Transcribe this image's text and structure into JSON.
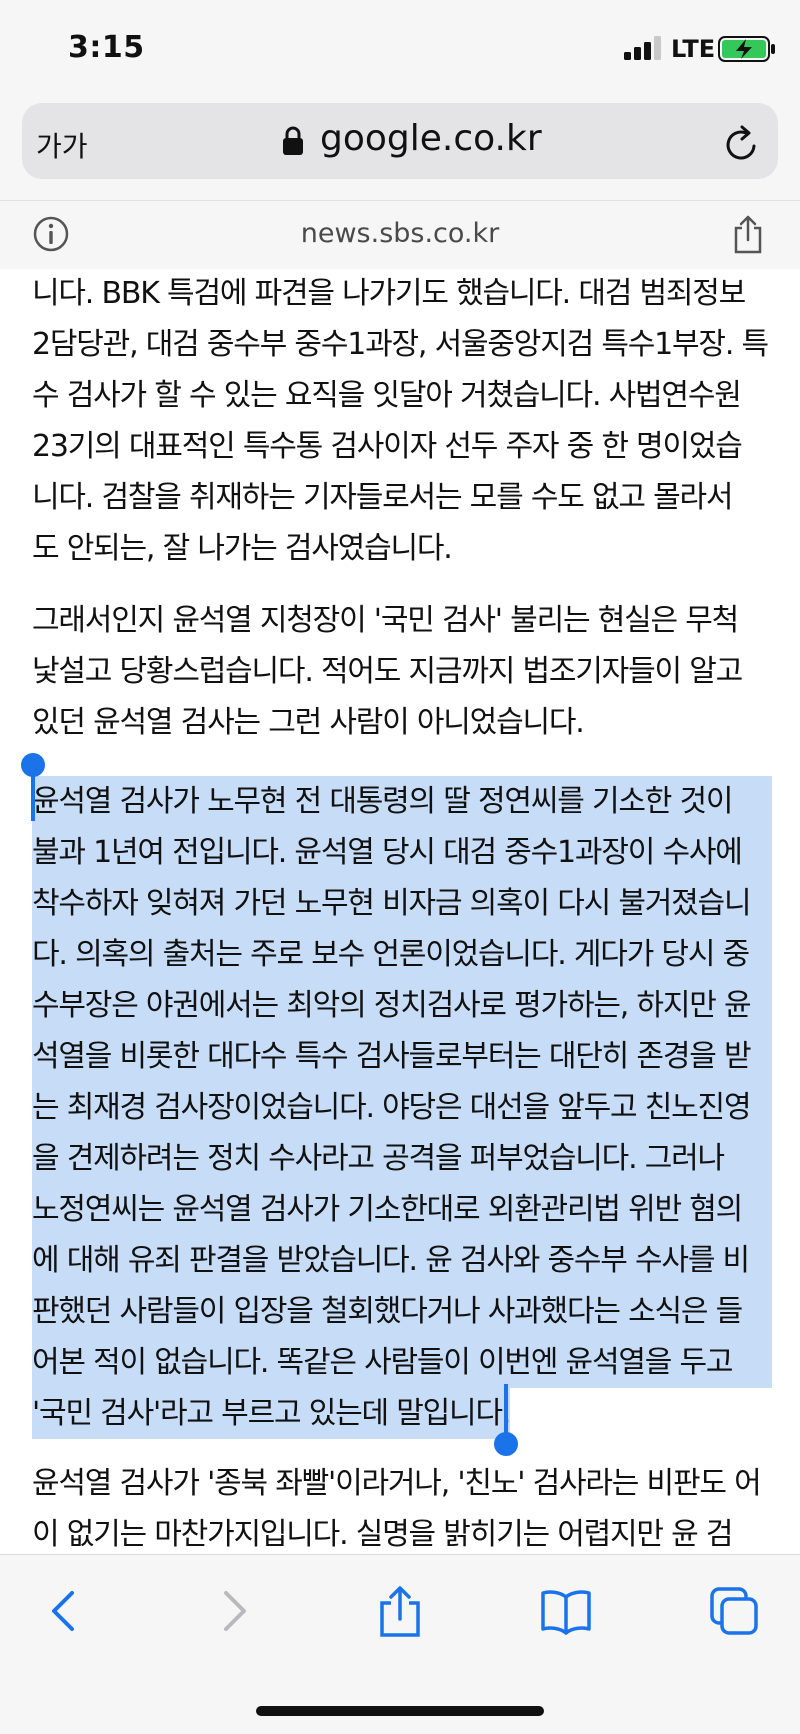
{
  "status_bar": {
    "time": "3:15",
    "network": "LTE",
    "battery_color": "#34c759"
  },
  "browser": {
    "text_size_label": "가가",
    "url": "google.co.kr",
    "site": "news.sbs.co.kr",
    "accent_color": "#1a73e8"
  },
  "article": {
    "paragraphs": [
      {
        "lines": [
          "니다. BBK 특검에 파견을 나가기도 했습니다.  대검 범죄정보",
          "2담당관, 대검 중수부 중수1과장, 서울중앙지검 특수1부장. 특",
          "수 검사가 할 수 있는 요직을 잇달아 거쳤습니다. 사법연수원",
          "23기의 대표적인 특수통 검사이자 선두 주자 중 한 명이었습",
          "니다. 검찰을 취재하는 기자들로서는 모를 수도 없고 몰라서",
          "도 안되는, 잘 나가는 검사였습니다."
        ]
      },
      {
        "lines": [
          "그래서인지 윤석열 지청장이 '국민 검사' 불리는 현실은 무척",
          "낯설고 당황스럽습니다. 적어도 지금까지 법조기자들이 알고",
          "있던 윤석열 검사는 그런 사람이 아니었습니다."
        ]
      },
      {
        "selected": true,
        "lines": [
          "윤석열 검사가 노무현 전 대통령의 딸 정연씨를 기소한 것이",
          "불과 1년여 전입니다.  윤석열 당시 대검 중수1과장이 수사에",
          "착수하자 잊혀져 가던 노무현 비자금 의혹이 다시 불거졌습니",
          "다. 의혹의 출처는 주로 보수 언론이었습니다. 게다가 당시 중",
          "수부장은 야권에서는 최악의 정치검사로 평가하는, 하지만 윤",
          "석열을 비롯한 대다수 특수 검사들로부터는 대단히 존경을 받",
          "는 최재경 검사장이었습니다. 야당은 대선을 앞두고 친노진영",
          "을 견제하려는 정치 수사라고 공격을 퍼부었습니다. 그러나",
          "노정연씨는 윤석열 검사가 기소한대로 외환관리법 위반 혐의",
          "에 대해 유죄 판결을 받았습니다. 윤 검사와 중수부 수사를 비",
          "판했던 사람들이 입장을 철회했다거나 사과했다는 소식은 들",
          "어본 적이 없습니다. 똑같은 사람들이 이번엔 윤석열을 두고",
          "'국민 검사'라고 부르고 있는데 말입니다."
        ]
      },
      {
        "lines": [
          "윤석열 검사가 '종북 좌빨'이라거나, '친노' 검사라는 비판도 어",
          "이 없기는 마찬가지입니다. 실명을 밝히기는 어렵지만 윤 검"
        ]
      }
    ]
  },
  "toolbar": {
    "items": [
      "back-icon",
      "forward-icon",
      "share-icon",
      "bookmarks-icon",
      "tabs-icon"
    ]
  }
}
